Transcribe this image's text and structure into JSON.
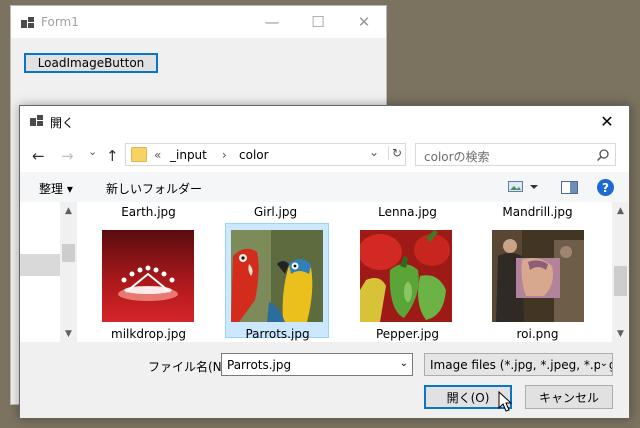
{
  "form1": {
    "title": "Form1",
    "minimize_glyph": "—",
    "maximize_glyph": "☐",
    "close_glyph": "✕",
    "load_button_label": "LoadImageButton"
  },
  "dialog": {
    "title": "開く",
    "close_glyph": "✕",
    "nav": {
      "back_glyph": "←",
      "forward_glyph": "→",
      "recent_glyph": "⌄",
      "up_glyph": "↑"
    },
    "address": {
      "overflow": "«",
      "crumbs": [
        "_input",
        "color"
      ],
      "separator": "›",
      "dropdown_glyph": "⌄",
      "refresh_glyph": "↻"
    },
    "search": {
      "placeholder": "colorの検索",
      "icon": "search-icon"
    },
    "toolbar": {
      "organize_label": "整理 ▾",
      "new_folder_label": "新しいフォルダー",
      "help_glyph": "?"
    },
    "top_row_names": [
      "Earth.jpg",
      "Girl.jpg",
      "Lenna.jpg",
      "Mandrill.jpg"
    ],
    "files": [
      {
        "name": "milkdrop.jpg",
        "selected": false
      },
      {
        "name": "Parrots.jpg",
        "selected": true
      },
      {
        "name": "Pepper.jpg",
        "selected": false
      },
      {
        "name": "roi.png",
        "selected": false
      }
    ],
    "filename_label": "ファイル名(N):",
    "filename_value": "Parrots.jpg",
    "filetype_value": "Image files (*.jpg, *.jpeg, *.png)",
    "open_button_label": "開く(O)",
    "cancel_button_label": "キャンセル"
  },
  "colors": {
    "desktop": "#7b725f",
    "accent": "#0a74c6",
    "selection": "#cce8ff"
  }
}
